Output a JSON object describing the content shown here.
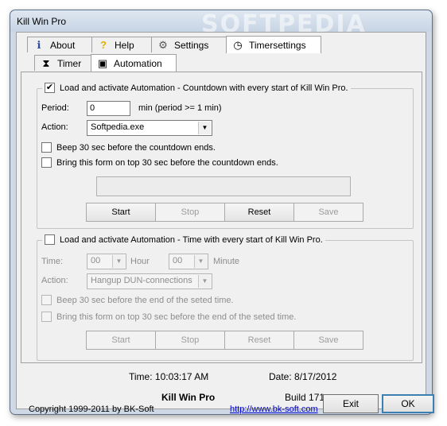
{
  "window": {
    "title": "Kill Win Pro",
    "watermark": "SOFTPEDIA"
  },
  "tabs": [
    {
      "label": "About",
      "icon": "info-icon"
    },
    {
      "label": "Help",
      "icon": "help-icon"
    },
    {
      "label": "Settings",
      "icon": "settings-icon"
    },
    {
      "label": "Timersettings",
      "icon": "clock-icon"
    }
  ],
  "subtabs": [
    {
      "label": "Timer",
      "icon": "hourglass-icon"
    },
    {
      "label": "Automation",
      "icon": "automation-icon"
    }
  ],
  "group1": {
    "checkbox_label": "Load and activate Automation - Countdown with every start of Kill Win Pro.",
    "checked": true,
    "period_label": "Period:",
    "period_value": "0",
    "period_hint": "min (period >= 1 min)",
    "action_label": "Action:",
    "action_value": "Softpedia.exe",
    "beep_label": "Beep 30 sec before the countdown ends.",
    "bring_label": "Bring this form on top 30 sec before the countdown ends.",
    "buttons": {
      "start": "Start",
      "stop": "Stop",
      "reset": "Reset",
      "save": "Save"
    }
  },
  "group2": {
    "checkbox_label": "Load and activate Automation - Time with every start of Kill Win Pro.",
    "checked": false,
    "time_label": "Time:",
    "hour_value": "00",
    "hour_label": "Hour",
    "minute_value": "00",
    "minute_label": "Minute",
    "action_label": "Action:",
    "action_value": "Hangup DUN-connections",
    "beep_label": "Beep 30 sec before the end of the seted time.",
    "bring_label": "Bring this form on top 30 sec before the end of the seted time.",
    "buttons": {
      "start": "Start",
      "stop": "Stop",
      "reset": "Reset",
      "save": "Save"
    }
  },
  "status": {
    "time": "Time: 10:03:17 AM",
    "date": "Date: 8/17/2012"
  },
  "footer": {
    "app_name": "Kill Win Pro",
    "build": "Build 171",
    "copyright": "Copyright 1999-2011 by BK-Soft",
    "url": "http://www.bk-soft.com",
    "exit_label": "Exit",
    "ok_label": "OK"
  }
}
